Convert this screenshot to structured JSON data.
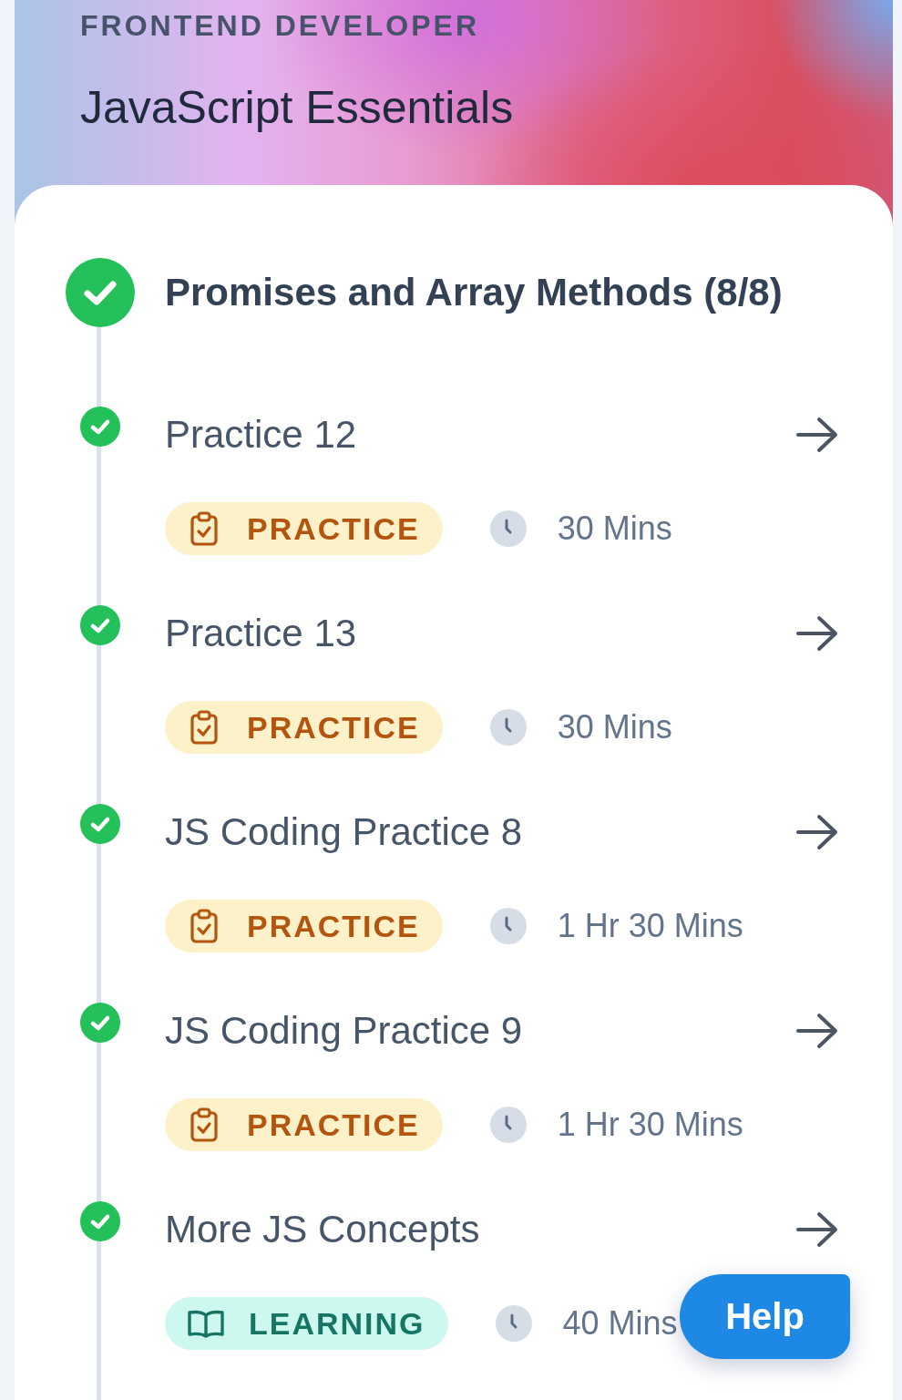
{
  "header": {
    "track": "FRONTEND DEVELOPER",
    "course": "JavaScript Essentials"
  },
  "module": {
    "title": "Promises and Array Methods (8/8)",
    "completed": true
  },
  "items": [
    {
      "title": "Practice 12",
      "completed": true,
      "kind": "practice",
      "tag": "PRACTICE",
      "duration": "30 Mins"
    },
    {
      "title": "Practice 13",
      "completed": true,
      "kind": "practice",
      "tag": "PRACTICE",
      "duration": "30 Mins"
    },
    {
      "title": "JS Coding Practice 8",
      "completed": true,
      "kind": "practice",
      "tag": "PRACTICE",
      "duration": "1 Hr 30 Mins"
    },
    {
      "title": "JS Coding Practice 9",
      "completed": true,
      "kind": "practice",
      "tag": "PRACTICE",
      "duration": "1 Hr 30 Mins"
    },
    {
      "title": "More JS Concepts",
      "completed": true,
      "kind": "learning",
      "tag": "LEARNING",
      "duration": "40 Mins"
    }
  ],
  "help_button": {
    "label": "Help"
  }
}
